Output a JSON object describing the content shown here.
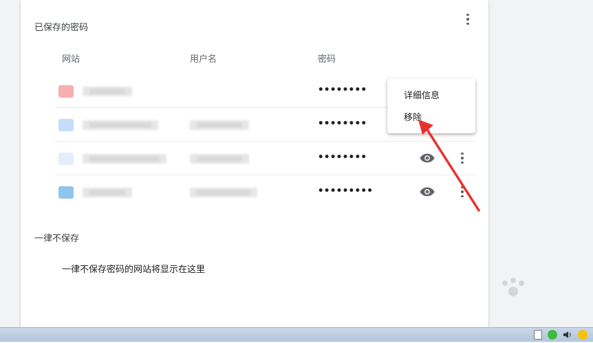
{
  "saved_passwords": {
    "title": "已保存的密码",
    "columns": {
      "site": "网站",
      "username": "用户名",
      "password": "密码"
    },
    "rows": [
      {
        "password_mask": "••••••••",
        "favicon_color": "#f28b82"
      },
      {
        "password_mask": "••••••••",
        "favicon_color": "#aecbfa"
      },
      {
        "password_mask": "••••••••",
        "favicon_color": "#d2e3fc"
      },
      {
        "password_mask": "•••••••••",
        "favicon_color": "#8ab4f8"
      }
    ]
  },
  "never_saved": {
    "title": "一律不保存",
    "empty_message": "一律不保存密码的网站将显示在这里"
  },
  "context_menu": {
    "details_label": "详细信息",
    "remove_label": "移除"
  },
  "icons": {
    "more": "more-vert-icon",
    "show_password": "eye-icon"
  },
  "colors": {
    "annotation_arrow": "#e8322d",
    "icon_gray": "#5f6368"
  }
}
